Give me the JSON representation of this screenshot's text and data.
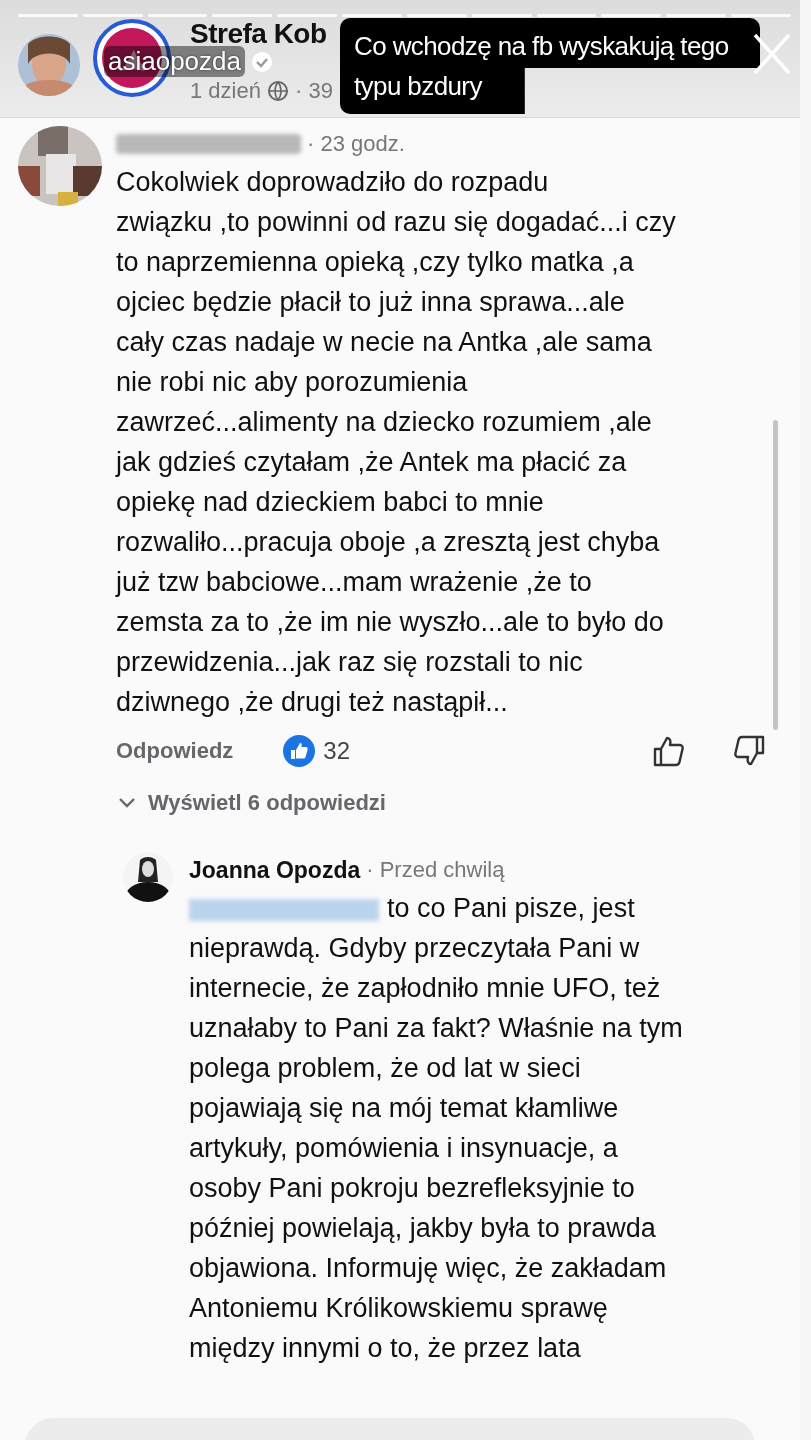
{
  "story": {
    "username": "asiaopozda",
    "verified": true,
    "caption": "Co wchodzę na fb wyskakują tego typu bzdury"
  },
  "post": {
    "page_name": "Strefa Kob",
    "time": "1 dzień",
    "age": "· 39"
  },
  "comment": {
    "time": "· 23 godz.",
    "lines": [
      "Cokolwiek doprowadziło do rozpadu",
      "związku ,to powinni od razu się dogadać...i czy",
      "to naprzemienna opieką ,czy tylko matka ,a",
      "ojciec będzie płacił to już inna sprawa...ale",
      "cały czas nadaje w necie na Antka ,ale sama",
      "nie robi nic aby porozumienia",
      "zawrzeć...alimenty na dziecko rozumiem ,ale",
      "jak gdzieś czytałam ,że Antek ma płacić za",
      "opiekę nad dzieckiem babci to mnie",
      "rozwaliło...pracuja oboje ,a zresztą jest chyba",
      "już tzw babciowe...mam wrażenie ,że to",
      "zemsta za to ,że im nie wyszło...ale to było do",
      "przewidzenia...jak raz się rozstali to nic",
      "dziwnego ,że drugi też nastąpił..."
    ],
    "reply_label": "Odpowiedz",
    "reactions": "32",
    "replies_link": "Wyświetl 6 odpowiedzi"
  },
  "reply": {
    "author": "Joanna Opozda",
    "time": "· Przed chwilą",
    "lines": [
      "to co Pani pisze, jest",
      "nieprawdą. Gdyby przeczytała Pani w",
      "internecie, że zapłodniło mnie UFO, też",
      "uznałaby to Pani za fakt? Właśnie na tym",
      "polega problem, że od lat w sieci",
      "pojawiają się na mój temat kłamliwe",
      "artykuły, pomówienia i insynuacje, a",
      "osoby Pani pokroju bezrefleksyjnie to",
      "później powielają, jakby była to prawda",
      "objawiona. Informuję więc, że zakładam",
      "Antoniemu Królikowskiemu sprawę",
      "między innymi o to, że przez lata"
    ]
  }
}
